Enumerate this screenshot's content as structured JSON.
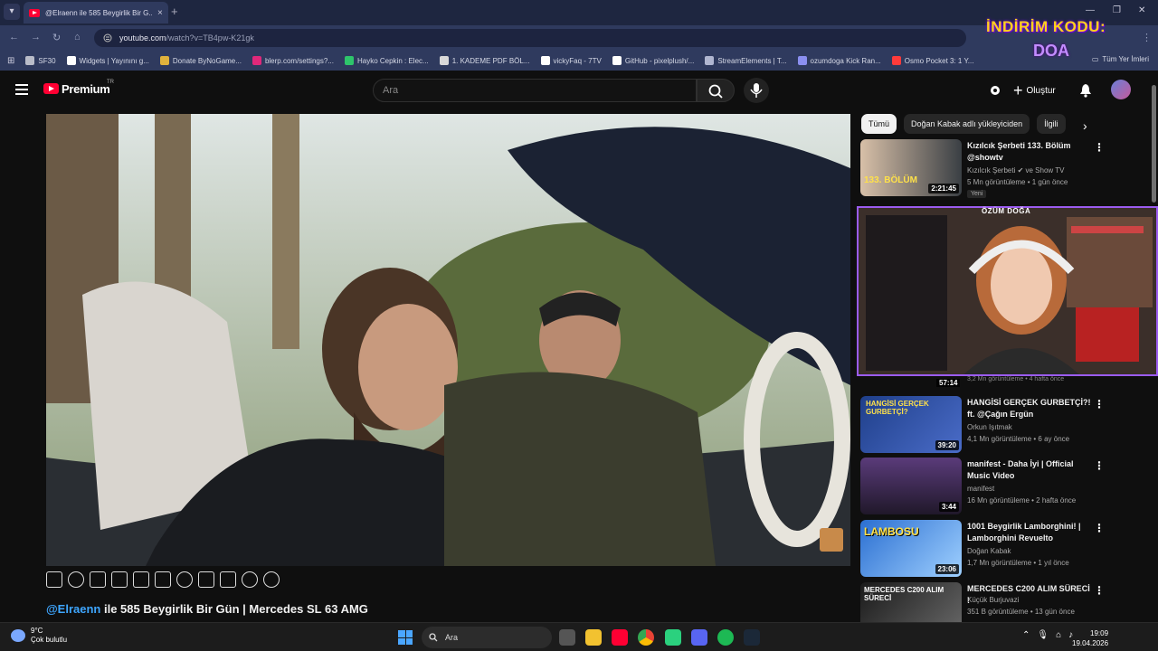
{
  "browser": {
    "tab_title": "@Elraenn ile 585 Beygirlik Bir G...",
    "tab_close": "×",
    "new_tab": "+",
    "url_host": "youtube.com",
    "url_path": "/watch?v=TB4pw-K21gk",
    "bookmarks": [
      {
        "label": "SF30",
        "color": "#b9bcc8"
      },
      {
        "label": "Widgets | Yayınını g...",
        "color": "#ffffff"
      },
      {
        "label": "Donate ByNoGame...",
        "color": "#e0b23c"
      },
      {
        "label": "blerp.com/settings?...",
        "color": "#e0287a"
      },
      {
        "label": "Hayko Cepkin : Elec...",
        "color": "#2ec56b"
      },
      {
        "label": "1. KADEME PDF BÖL...",
        "color": "#d8d8d8"
      },
      {
        "label": "vickyFaq - 7TV",
        "color": "#ffffff"
      },
      {
        "label": "GitHub - pixelplush/...",
        "color": "#ffffff"
      },
      {
        "label": "StreamElements | T...",
        "color": "#b0b6d0"
      },
      {
        "label": "ozumdoga Kick Ran...",
        "color": "#8b8ff0"
      },
      {
        "label": "Osmo Pocket 3: 1 Y...",
        "color": "#ff3b3b"
      }
    ],
    "all_bookmarks": "Tüm Yer İmleri",
    "promo_text": "İNDİRİM KODU:",
    "promo_code": "DOA"
  },
  "youtube": {
    "logo_text": "Premium",
    "country": "TR",
    "search_placeholder": "Ara",
    "create_label": "Oluştur",
    "video_title_mention": "@Elraenn",
    "video_title_rest": " ile 585 Beygirlik Bir Gün | Mercedes SL 63 AMG",
    "chips": [
      "Tümü",
      "Doğan Kabak adlı yükleyiciden",
      "İlgili"
    ],
    "webcam_name": "ÖZÜM DOĞA",
    "hidden_row_duration": "57:14",
    "hidden_row_meta": "3,2 Mn görüntüleme • 4 hafta önce",
    "recommendations": [
      {
        "title": "Kızılcık Şerbeti 133. Bölüm @showtv",
        "channel": "Kızılcık Şerbeti ✔ ve Show TV",
        "meta": "5 Mn görüntüleme • 1 gün önce",
        "duration": "2:21:45",
        "badge": "Yeni",
        "thumb_text": "133. BÖLÜM"
      },
      {
        "title": "HANGİSİ GERÇEK GURBETÇİ?! ft. @Çağın Ergün",
        "channel": "Orkun Işıtmak",
        "meta": "4,1 Mn görüntüleme • 6 ay önce",
        "duration": "39:20",
        "thumb_text": "HANGİSİ GERÇEK GURBETÇİ?"
      },
      {
        "title": "manifest - Daha İyi | Official Music Video",
        "channel": "manifest",
        "meta": "16 Mn görüntüleme • 2 hafta önce",
        "duration": "3:44",
        "thumb_text": ""
      },
      {
        "title": "1001 Beygirlik Lamborghini! | Lamborghini Revuelto",
        "channel": "Doğan Kabak",
        "meta": "1,7 Mn görüntüleme • 1 yıl önce",
        "duration": "23:06",
        "thumb_text": "LAMBOSU"
      },
      {
        "title": "MERCEDES C200 ALIM SÜRECİ !",
        "channel": "Küçük Burjuvazi",
        "meta": "351 B görüntüleme • 13 gün önce",
        "duration": "",
        "thumb_text": "MERCEDES C200 ALIM SÜRECİ"
      }
    ]
  },
  "taskbar": {
    "temperature": "9°C",
    "weather": "Çok bulutlu",
    "search_label": "Ara",
    "time": "19:09",
    "date": "19.04.2026"
  },
  "colors": {
    "chrome_bg": "#2f3a5e",
    "yt_red": "#ff0033",
    "mention_blue": "#3ea6ff",
    "promo_yellow": "#ffd21a",
    "webcam_purple": "#9b5cf0"
  }
}
